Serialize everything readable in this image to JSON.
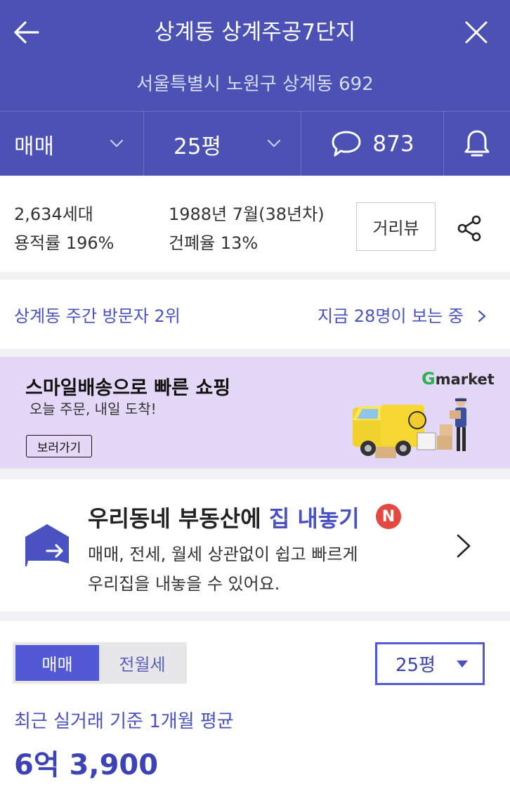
{
  "header": {
    "title": "상계동 상계주공7단지",
    "address": "서울특별시 노원구 상계동 692",
    "trade_type": "매매",
    "size": "25평",
    "comment_count": "873"
  },
  "info": {
    "households": "2,634세대",
    "floor_area_ratio": "용적률 196%",
    "built": "1988년 7월(38년차)",
    "building_coverage": "건폐율 13%",
    "street_view_label": "거리뷰"
  },
  "visit": {
    "rank_text": "상계동 주간 방문자 2위",
    "viewers_text": "지금 28명이 보는 중"
  },
  "ad": {
    "title": "스마일배송으로 빠른 쇼핑",
    "subtitle": "오늘 주문, 내일 도착!",
    "button": "보러가기",
    "logo_g": "G",
    "logo_rest": "market"
  },
  "listing": {
    "title_prefix": "우리동네 부동산에 ",
    "title_accent": "집 내놓기",
    "badge": "N",
    "desc_line1": "매매, 전세, 월세 상관없이 쉽고 빠르게",
    "desc_line2": "우리집을 내놓을 수 있어요."
  },
  "price": {
    "tabs": [
      "매매",
      "전월세"
    ],
    "size_select": "25평",
    "label": "최근 실거래 기준 1개월 평균",
    "value": "6억 3,900"
  },
  "colors": {
    "brand": "#4c52b4",
    "accent": "#4a52c2",
    "badge": "#e34841",
    "ad_bg": "#e3d8f7"
  }
}
